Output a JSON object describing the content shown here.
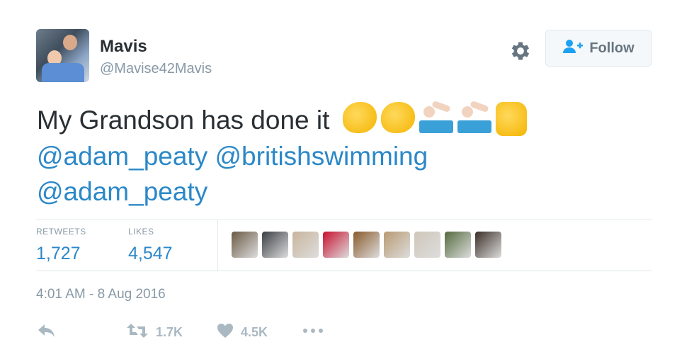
{
  "author": {
    "name": "Mavis",
    "handle": "@Mavise42Mavis"
  },
  "follow_button": {
    "label": "Follow"
  },
  "tweet": {
    "text": "My Grandson has done it",
    "emojis": [
      "clapping-hands",
      "clapping-hands",
      "swimmer",
      "swimmer",
      "thumbs-up"
    ],
    "mentions_line1": [
      "@adam_peaty",
      "@britishswimming"
    ],
    "mentions_line2": [
      "@adam_peaty"
    ]
  },
  "stats": {
    "retweets_label": "RETWEETS",
    "retweets_value": "1,727",
    "likes_label": "LIKES",
    "likes_value": "4,547"
  },
  "likers": [
    {
      "name": "liker-avatar-1",
      "color": "#6a5a44"
    },
    {
      "name": "liker-avatar-2",
      "color": "#3b3f44"
    },
    {
      "name": "liker-avatar-3",
      "color": "#c9b59c"
    },
    {
      "name": "liker-avatar-4",
      "color": "#c8102e"
    },
    {
      "name": "liker-avatar-5",
      "color": "#8a5a2b"
    },
    {
      "name": "liker-avatar-6",
      "color": "#b89a72"
    },
    {
      "name": "liker-avatar-7",
      "color": "#cfc6b8"
    },
    {
      "name": "liker-avatar-8",
      "color": "#556b3e"
    },
    {
      "name": "liker-avatar-9",
      "color": "#3a2e27"
    }
  ],
  "timestamp": "4:01 AM - 8 Aug 2016",
  "actions": {
    "retweet_count": "1.7K",
    "like_count": "4.5K"
  },
  "colors": {
    "link": "#2b88c8",
    "muted": "#8899a6",
    "text": "#292f33",
    "border": "#e1e8ed"
  }
}
